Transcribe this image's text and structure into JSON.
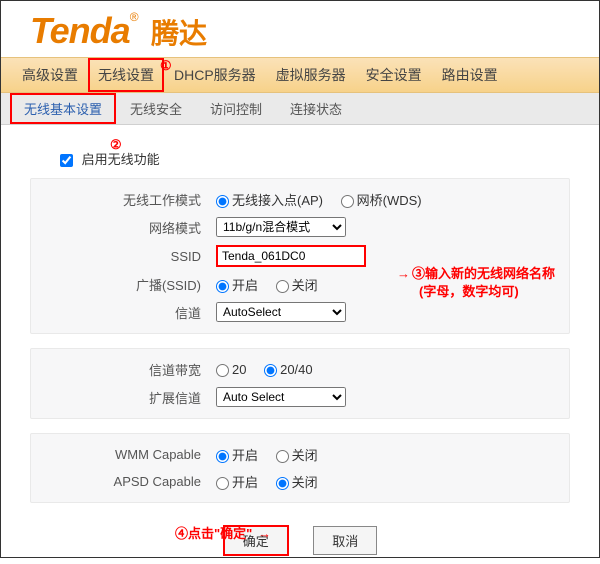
{
  "logo": {
    "brand": "Tenda",
    "reg": "®",
    "cn": "腾达"
  },
  "callouts": {
    "c1": "①",
    "c2": "②",
    "c3a": "③输入新的无线网络名称",
    "c3b": "(字母，数字均可)",
    "c4": "④点击\"确定\""
  },
  "nav_main": [
    "高级设置",
    "无线设置",
    "DHCP服务器",
    "虚拟服务器",
    "安全设置",
    "路由设置"
  ],
  "nav_sub": [
    "无线基本设置",
    "无线安全",
    "访问控制",
    "连接状态"
  ],
  "enable_label": "启用无线功能",
  "groups": {
    "g1": {
      "work_mode": {
        "label": "无线工作模式",
        "opt1": "无线接入点(AP)",
        "opt2": "网桥(WDS)"
      },
      "net_mode": {
        "label": "网络模式",
        "value": "11b/g/n混合模式"
      },
      "ssid": {
        "label": "SSID",
        "value": "Tenda_061DC0"
      },
      "broadcast": {
        "label": "广播(SSID)",
        "opt1": "开启",
        "opt2": "关闭"
      },
      "channel": {
        "label": "信道",
        "value": "AutoSelect"
      }
    },
    "g2": {
      "bw": {
        "label": "信道带宽",
        "opt1": "20",
        "opt2": "20/40"
      },
      "ext": {
        "label": "扩展信道",
        "value": "Auto Select"
      }
    },
    "g3": {
      "wmm": {
        "label": "WMM Capable",
        "opt1": "开启",
        "opt2": "关闭"
      },
      "apsd": {
        "label": "APSD Capable",
        "opt1": "开启",
        "opt2": "关闭"
      }
    }
  },
  "buttons": {
    "ok": "确定",
    "cancel": "取消"
  },
  "arrow": "→"
}
